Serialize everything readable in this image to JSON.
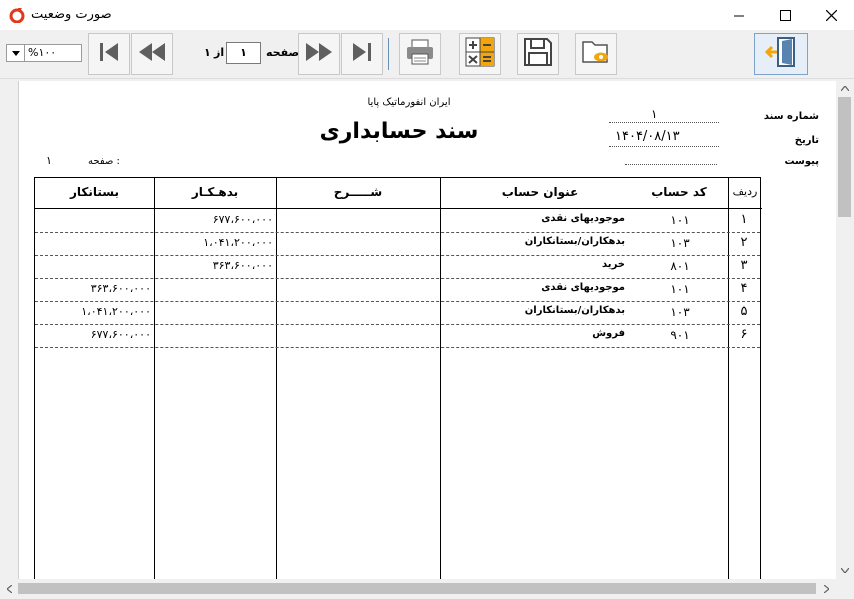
{
  "window": {
    "title": "صورت وضعیت",
    "icon": "app-logo-icon",
    "controls": [
      "minimize-icon",
      "maximize-icon",
      "close-icon"
    ]
  },
  "toolbar": {
    "zoom": "%۱۰۰",
    "page_label": "صفحه",
    "page_current": "۱",
    "of_label": "از",
    "page_total": "۱",
    "buttons": [
      "first-page-icon",
      "previous-page-icon",
      "next-page-icon",
      "last-page-icon",
      "print-icon",
      "calculator-icon",
      "save-icon",
      "open-folder-icon",
      "exit-icon"
    ]
  },
  "report": {
    "company": "ایران انفورماتیک پایا",
    "title": "سند حسابداری",
    "doc_number_label": "شماره سند",
    "doc_number": "۱",
    "date_label": "تاریخ",
    "date": "۱۴۰۴/۰۸/۱۳",
    "attachment_label": "پیوست",
    "attachment": "",
    "page_label": "صفحه :",
    "page_number": "۱",
    "columns": {
      "row": "ردیف",
      "code": "کد حساب",
      "account": "عنوان حساب",
      "desc": "شـــــرح",
      "debit": "بدهـکـار",
      "credit": "بستانکار"
    },
    "rows": [
      {
        "row": "۱",
        "code": "۱۰۱",
        "account": "موجودیهای نقدی",
        "desc": "",
        "debit": "۶۷۷،۶۰۰،۰۰۰",
        "credit": ""
      },
      {
        "row": "۲",
        "code": "۱۰۳",
        "account": "بدهکاران/بستانکاران",
        "desc": "",
        "debit": "۱،۰۴۱،۲۰۰،۰۰۰",
        "credit": ""
      },
      {
        "row": "۳",
        "code": "۸۰۱",
        "account": "خرید",
        "desc": "",
        "debit": "۳۶۳،۶۰۰،۰۰۰",
        "credit": ""
      },
      {
        "row": "۴",
        "code": "۱۰۱",
        "account": "موجودیهای نقدی",
        "desc": "",
        "debit": "",
        "credit": "۳۶۳،۶۰۰،۰۰۰"
      },
      {
        "row": "۵",
        "code": "۱۰۳",
        "account": "بدهکاران/بستانکاران",
        "desc": "",
        "debit": "",
        "credit": "۱،۰۴۱،۲۰۰،۰۰۰"
      },
      {
        "row": "۶",
        "code": "۹۰۱",
        "account": "فروش",
        "desc": "",
        "debit": "",
        "credit": "۶۷۷،۶۰۰،۰۰۰"
      }
    ]
  }
}
